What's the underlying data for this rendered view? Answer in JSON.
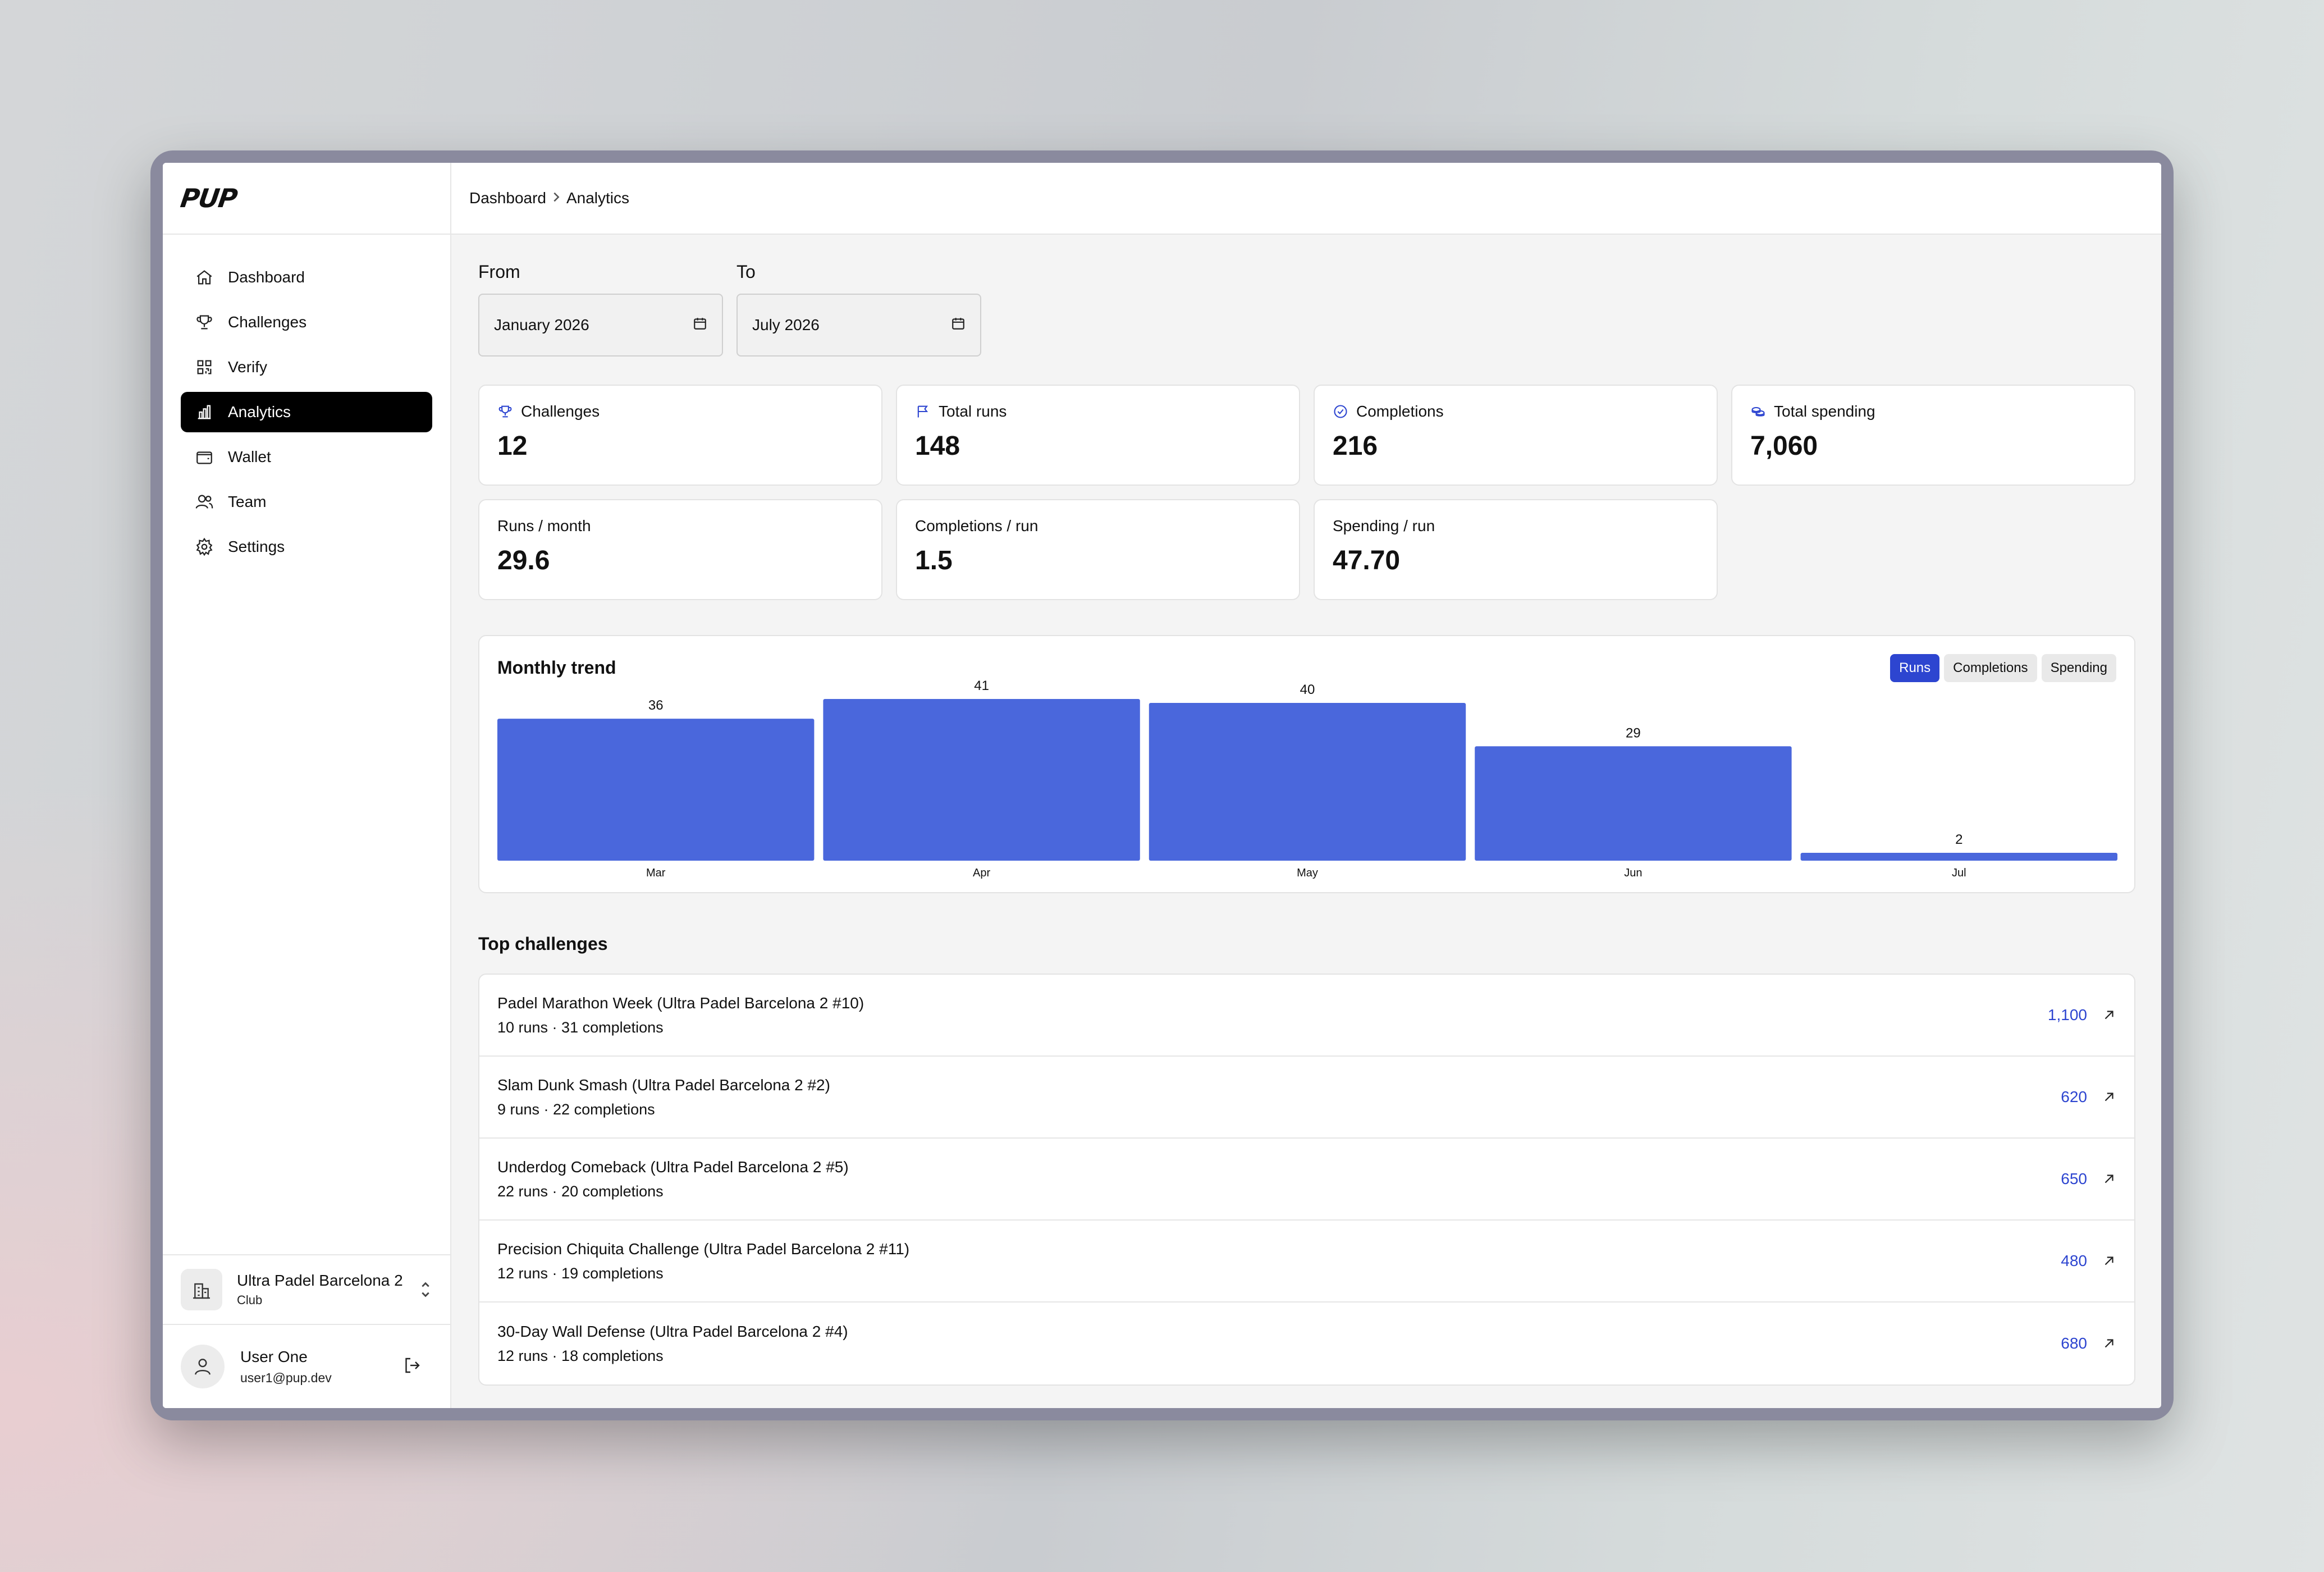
{
  "app": {
    "logo": "PUP"
  },
  "breadcrumb": {
    "parent": "Dashboard",
    "current": "Analytics"
  },
  "sidebar": {
    "items": [
      {
        "label": "Dashboard",
        "icon": "home-icon"
      },
      {
        "label": "Challenges",
        "icon": "trophy-icon"
      },
      {
        "label": "Verify",
        "icon": "qr-code-icon"
      },
      {
        "label": "Analytics",
        "icon": "bar-chart-icon",
        "active": true
      },
      {
        "label": "Wallet",
        "icon": "wallet-icon"
      },
      {
        "label": "Team",
        "icon": "users-icon"
      },
      {
        "label": "Settings",
        "icon": "gear-icon"
      }
    ],
    "club": {
      "name": "Ultra Padel Barcelona 2",
      "type": "Club"
    },
    "user": {
      "name": "User One",
      "email": "user1@pup.dev"
    }
  },
  "filters": {
    "from_label": "From",
    "from_value": "January 2026",
    "to_label": "To",
    "to_value": "July 2026"
  },
  "stats": [
    {
      "label": "Challenges",
      "value": "12",
      "icon": "trophy-icon"
    },
    {
      "label": "Total runs",
      "value": "148",
      "icon": "flag-icon"
    },
    {
      "label": "Completions",
      "value": "216",
      "icon": "check-circle-icon"
    },
    {
      "label": "Total spending",
      "value": "7,060",
      "icon": "coins-icon"
    },
    {
      "label": "Runs / month",
      "value": "29.6"
    },
    {
      "label": "Completions / run",
      "value": "1.5"
    },
    {
      "label": "Spending / run",
      "value": "47.70"
    }
  ],
  "trend": {
    "title": "Monthly trend",
    "toggles": [
      "Runs",
      "Completions",
      "Spending"
    ],
    "active_toggle": "Runs"
  },
  "chart_data": {
    "type": "bar",
    "title": "Monthly trend",
    "categories": [
      "Mar",
      "Apr",
      "May",
      "Jun",
      "Jul"
    ],
    "values": [
      36,
      41,
      40,
      29,
      2
    ],
    "xlabel": "",
    "ylabel": "",
    "ylim": [
      0,
      41
    ],
    "grid": false,
    "color": "#4a67dc"
  },
  "top_challenges": {
    "title": "Top challenges",
    "rows": [
      {
        "name": "Padel Marathon Week (Ultra Padel Barcelona 2 #10)",
        "meta": "10 runs · 31 completions",
        "value": "1,100"
      },
      {
        "name": "Slam Dunk Smash (Ultra Padel Barcelona 2 #2)",
        "meta": "9 runs · 22 completions",
        "value": "620"
      },
      {
        "name": "Underdog Comeback (Ultra Padel Barcelona 2 #5)",
        "meta": "22 runs · 20 completions",
        "value": "650"
      },
      {
        "name": "Precision Chiquita Challenge (Ultra Padel Barcelona 2 #11)",
        "meta": "12 runs · 19 completions",
        "value": "480"
      },
      {
        "name": "30-Day Wall Defense (Ultra Padel Barcelona 2 #4)",
        "meta": "12 runs · 18 completions",
        "value": "680"
      }
    ]
  },
  "colors": {
    "accent": "#2d45d0",
    "bar": "#4a67dc",
    "active_nav": "#000000"
  }
}
